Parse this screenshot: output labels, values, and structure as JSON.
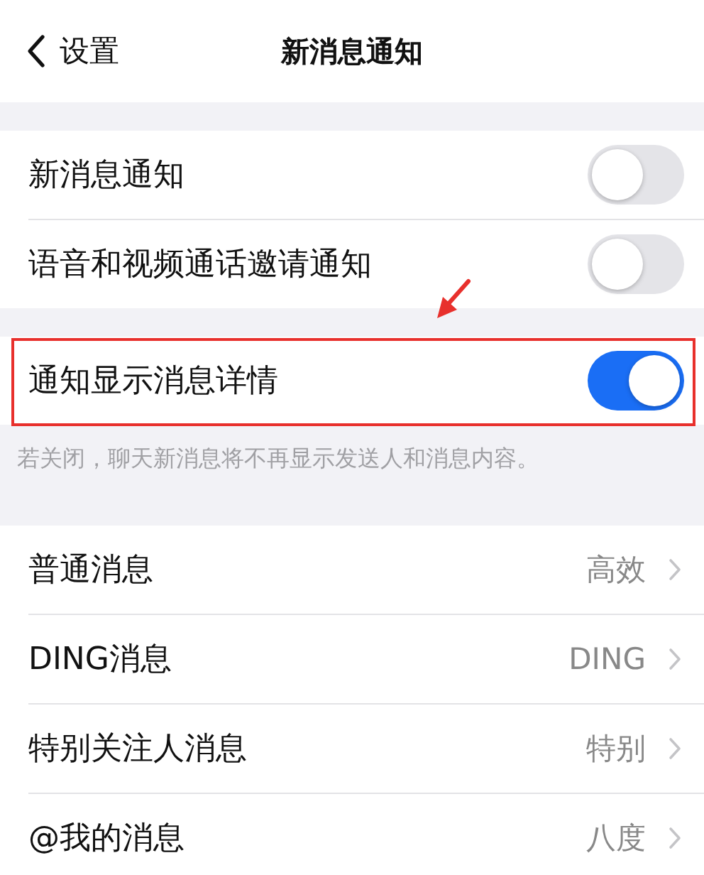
{
  "nav_bar": {
    "back_label": "设置",
    "title": "新消息通知"
  },
  "sections": [
    {
      "rows": [
        {
          "kind": "toggle",
          "label": "新消息通知",
          "on": false,
          "highlighted": false
        },
        {
          "kind": "toggle",
          "label": "语音和视频通话邀请通知",
          "on": false,
          "highlighted": false
        }
      ]
    },
    {
      "rows": [
        {
          "kind": "toggle",
          "label": "通知显示消息详情",
          "on": true,
          "highlighted": true
        }
      ],
      "footer": "若关闭，聊天新消息将不再显示发送人和消息内容。"
    },
    {
      "rows": [
        {
          "kind": "link",
          "label": "普通消息",
          "value": "高效"
        },
        {
          "kind": "link",
          "label": "DING消息",
          "value": "DING"
        },
        {
          "kind": "link",
          "label": "特别关注人消息",
          "value": "特别"
        },
        {
          "kind": "link",
          "label": "@我的消息",
          "value": "八度"
        }
      ]
    }
  ]
}
